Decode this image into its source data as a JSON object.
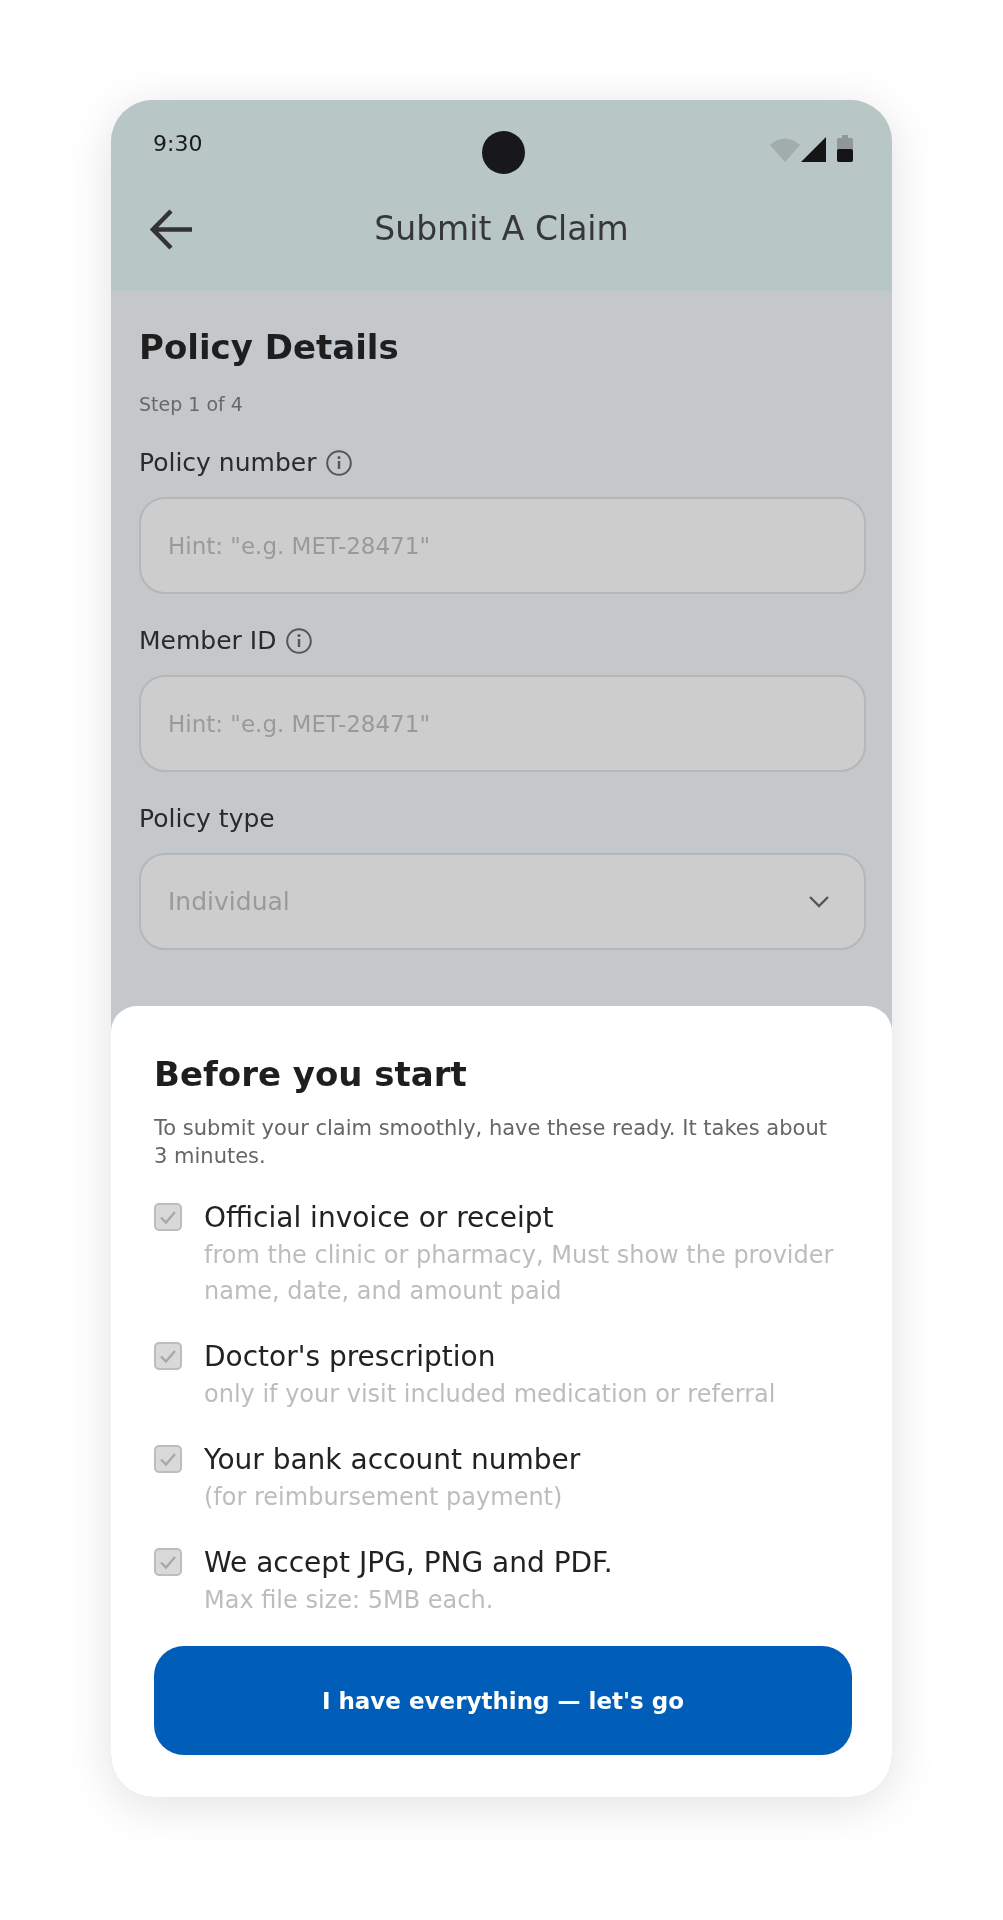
{
  "status_bar": {
    "time": "9:30"
  },
  "app_bar": {
    "title": "Submit A Claim"
  },
  "form": {
    "title": "Policy Details",
    "step": "Step 1 of 4",
    "fields": [
      {
        "kind": "text",
        "label": "Policy number",
        "info": true,
        "placeholder": "Hint: \"e.g. MET-28471\""
      },
      {
        "kind": "text",
        "label": "Member ID",
        "info": true,
        "placeholder": "Hint: \"e.g. MET-28471\""
      },
      {
        "kind": "select",
        "label": "Policy type",
        "info": false,
        "value": "Individual"
      }
    ]
  },
  "sheet": {
    "title": "Before you start",
    "description": "To submit your claim smoothly, have these ready. It takes about 3 minutes.",
    "items": [
      {
        "title": "Official invoice or receipt",
        "detail": "from the clinic or pharmacy, Must show the provider name, date, and amount paid",
        "checked": true
      },
      {
        "title": "Doctor's prescription",
        "detail": "only if your visit included medication or referral",
        "checked": true
      },
      {
        "title": "Your bank account number",
        "detail": "(for reimbursement payment)",
        "checked": true
      },
      {
        "title": "We accept JPG, PNG and PDF.",
        "detail": "Max file size: 5MB each.",
        "checked": true
      }
    ],
    "button": "I have everything — let's go"
  }
}
